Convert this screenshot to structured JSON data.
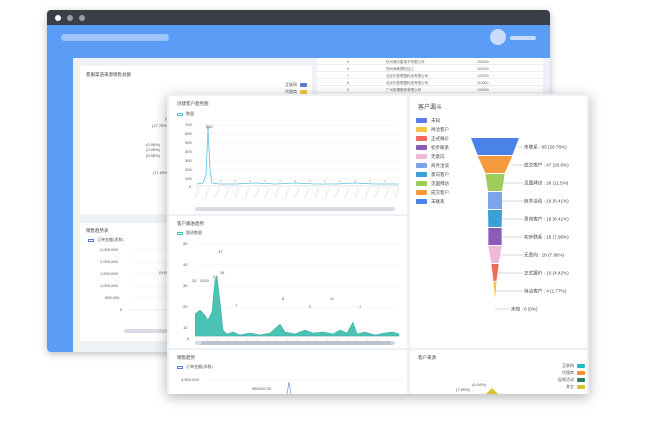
{
  "back": {
    "table_rows": [
      {
        "idx": "5",
        "name": "杭州满天星电子有限公司",
        "value": "150000"
      },
      {
        "idx": "6",
        "name": "郑州海粤塑料加工",
        "value": "180000"
      },
      {
        "idx": "7",
        "name": "北京华夏联盟科技有限公司",
        "value": "120000"
      },
      {
        "idx": "8",
        "name": "北京华夏联盟科技有限公司",
        "value": "110000"
      },
      {
        "idx": "9",
        "name": "广州彩蝶服饰有限公司",
        "value": "100000"
      }
    ],
    "pie_panel": {
      "title": "客服渠道来源销售总额",
      "legend": [
        {
          "label": "互联网",
          "color": "#5b7be0"
        },
        {
          "label": "代理商",
          "color": "#f5c344"
        },
        {
          "label": "促销活动",
          "color": "#ee6a5b"
        }
      ],
      "labels": [
        "(4.1%)",
        "(0.65%)",
        "(17.78%)",
        "(0.98%)",
        "(3.95%)",
        "(5.88%)",
        "(71.89%)"
      ]
    },
    "sales_panel": {
      "title": "销售趋势表",
      "legend": "订单金额(求和)",
      "yticks": [
        "2,000,000",
        "2,000,000",
        "1,500,000",
        "1,000,000",
        "500,000",
        "0"
      ],
      "point_label": "1500000.00"
    }
  },
  "front": {
    "chart1": {
      "title": "创建客户趋势图",
      "legend": "数量",
      "peak_label": "580",
      "yticks": [
        "700",
        "600",
        "500",
        "400",
        "300",
        "200",
        "100",
        "0"
      ]
    },
    "chart2": {
      "title": "客户跟进趋势",
      "legend": "跟进数量",
      "yticks": [
        "50",
        "40",
        "30",
        "20",
        "10",
        "0"
      ],
      "labels": [
        "47",
        "34",
        "24",
        "20",
        "2019",
        "8",
        "7",
        "5",
        "4",
        "11"
      ]
    },
    "chart3": {
      "title": "销售趋势",
      "legend": "订单金额(求和)",
      "ytick": "3,500,000",
      "point_label": "980000.00"
    },
    "chart4": {
      "title": "客户来源",
      "legend": [
        {
          "label": "互联网",
          "color": "#28b3c8"
        },
        {
          "label": "代理商",
          "color": "#f28c38"
        },
        {
          "label": "促销活动",
          "color": "#2d7a5c"
        },
        {
          "label": "其它",
          "color": "#e0c02e"
        }
      ],
      "labels": [
        "(4.04%)",
        "(7.89%)"
      ]
    },
    "funnel": {
      "title": "客户漏斗",
      "legend": [
        {
          "label": "未知",
          "color": "#5b7be0"
        },
        {
          "label": "待洽客户",
          "color": "#f5c344"
        },
        {
          "label": "正式报价",
          "color": "#ee6a5b"
        },
        {
          "label": "初步联系",
          "color": "#8b5bb8"
        },
        {
          "label": "无意向",
          "color": "#f0b8d8"
        },
        {
          "label": "商务洽谈",
          "color": "#7fa3e8"
        },
        {
          "label": "意向客户",
          "color": "#3aa0d8"
        },
        {
          "label": "见面拜访",
          "color": "#9ccc5a"
        },
        {
          "label": "成交客户",
          "color": "#f59a3c"
        },
        {
          "label": "未联系",
          "color": "#4a82e8"
        }
      ],
      "stages": [
        {
          "label": "未联系 : 65 (28.76%)",
          "color": "#4a82e8"
        },
        {
          "label": "成交客户 : 47 (20.8%)",
          "color": "#f59a3c"
        },
        {
          "label": "见面拜访 : 26 (11.5%)",
          "color": "#9ccc5a"
        },
        {
          "label": "商务洽谈 : 19 (8.41%)",
          "color": "#7fa3e8"
        },
        {
          "label": "意向客户 : 19 (8.41%)",
          "color": "#3aa0d8"
        },
        {
          "label": "初步联系 : 18 (7.96%)",
          "color": "#8b5bb8"
        },
        {
          "label": "无意向 : 18 (7.96%)",
          "color": "#f0b8d8"
        },
        {
          "label": "正式报价 : 10 (4.42%)",
          "color": "#ee6a5b"
        },
        {
          "label": "待洽客户 : 4 (1.77%)",
          "color": "#f5c344"
        },
        {
          "label": "未知 : 0 (0%)",
          "color": "#5b7be0"
        }
      ]
    }
  }
}
